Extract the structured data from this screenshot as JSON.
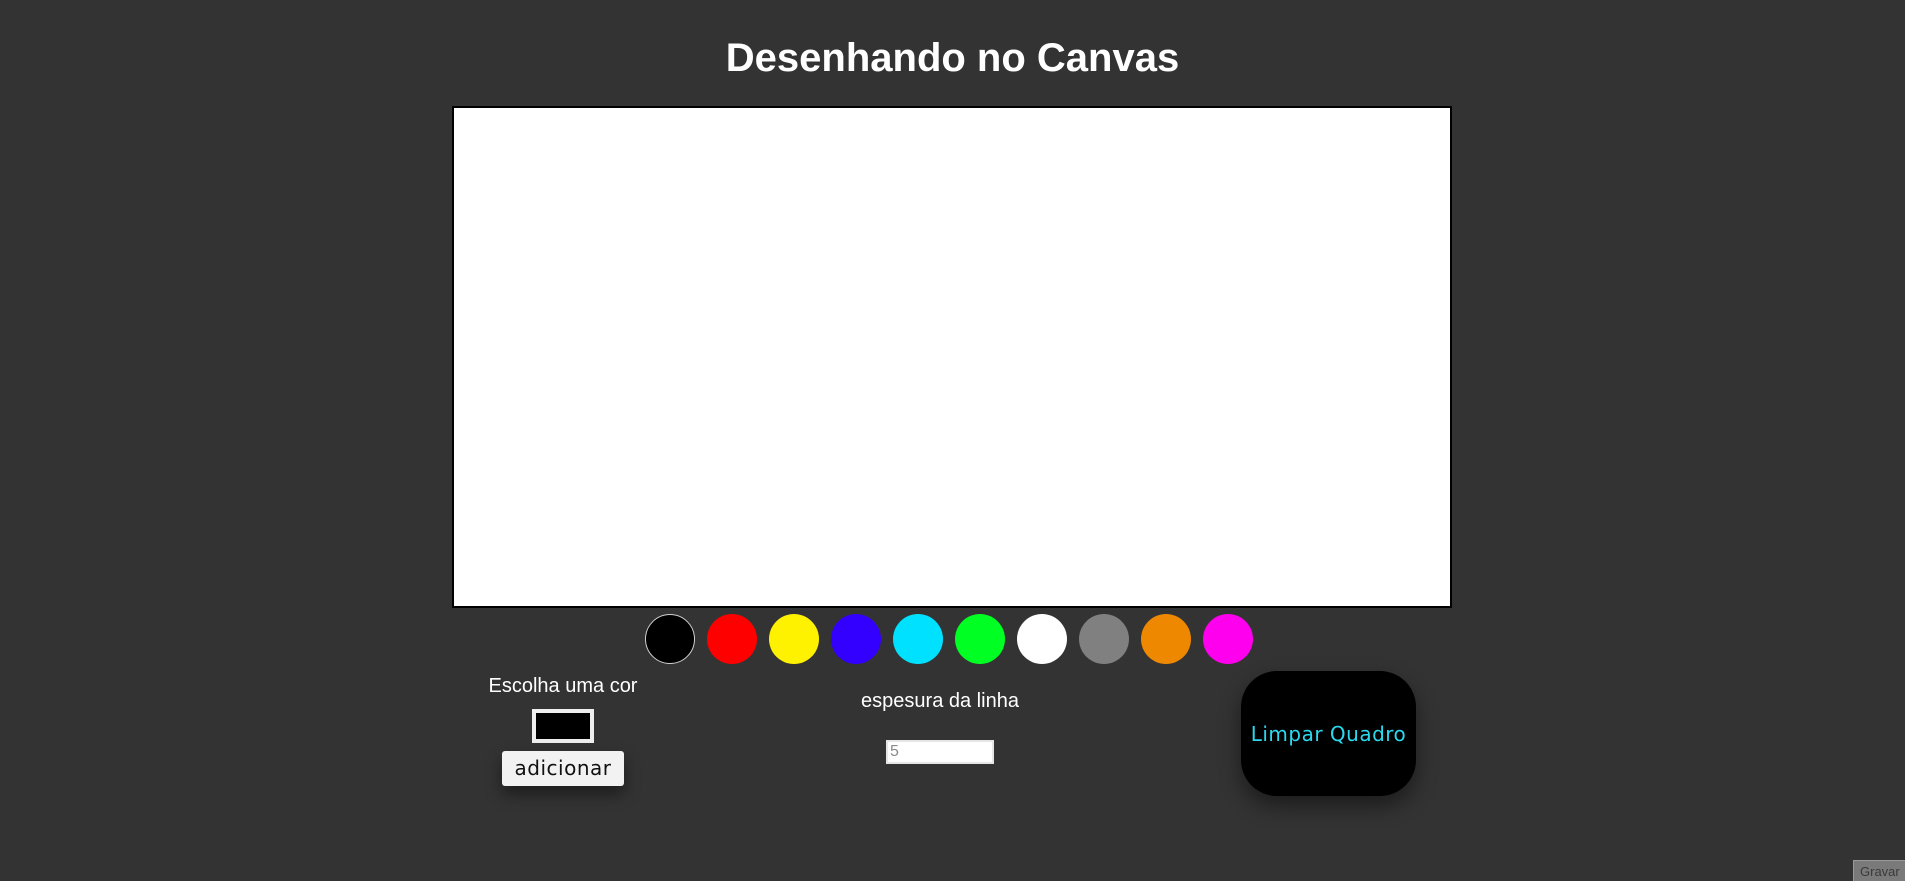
{
  "header": {
    "title": "Desenhando no Canvas"
  },
  "palette": {
    "swatches": [
      {
        "name": "black",
        "color": "#000000",
        "selected": true
      },
      {
        "name": "red",
        "color": "#ff0000",
        "selected": false
      },
      {
        "name": "yellow",
        "color": "#fff200",
        "selected": false
      },
      {
        "name": "blue",
        "color": "#3300ff",
        "selected": false
      },
      {
        "name": "cyan",
        "color": "#00e1ff",
        "selected": false
      },
      {
        "name": "green",
        "color": "#00ff22",
        "selected": false
      },
      {
        "name": "white",
        "color": "#ffffff",
        "selected": false
      },
      {
        "name": "gray",
        "color": "#808080",
        "selected": false
      },
      {
        "name": "orange",
        "color": "#ee8800",
        "selected": false
      },
      {
        "name": "magenta",
        "color": "#ff00ee",
        "selected": false
      }
    ]
  },
  "color_picker": {
    "label": "Escolha uma cor",
    "value": "#000000",
    "add_label": "adicionar"
  },
  "line_width": {
    "label": "espesura da linha",
    "value": "5"
  },
  "actions": {
    "clear_label": "Limpar Quadro",
    "record_label": "Gravar"
  },
  "colors": {
    "background": "#333333",
    "canvas": "#ffffff",
    "clear_text": "#2ad9ee"
  }
}
